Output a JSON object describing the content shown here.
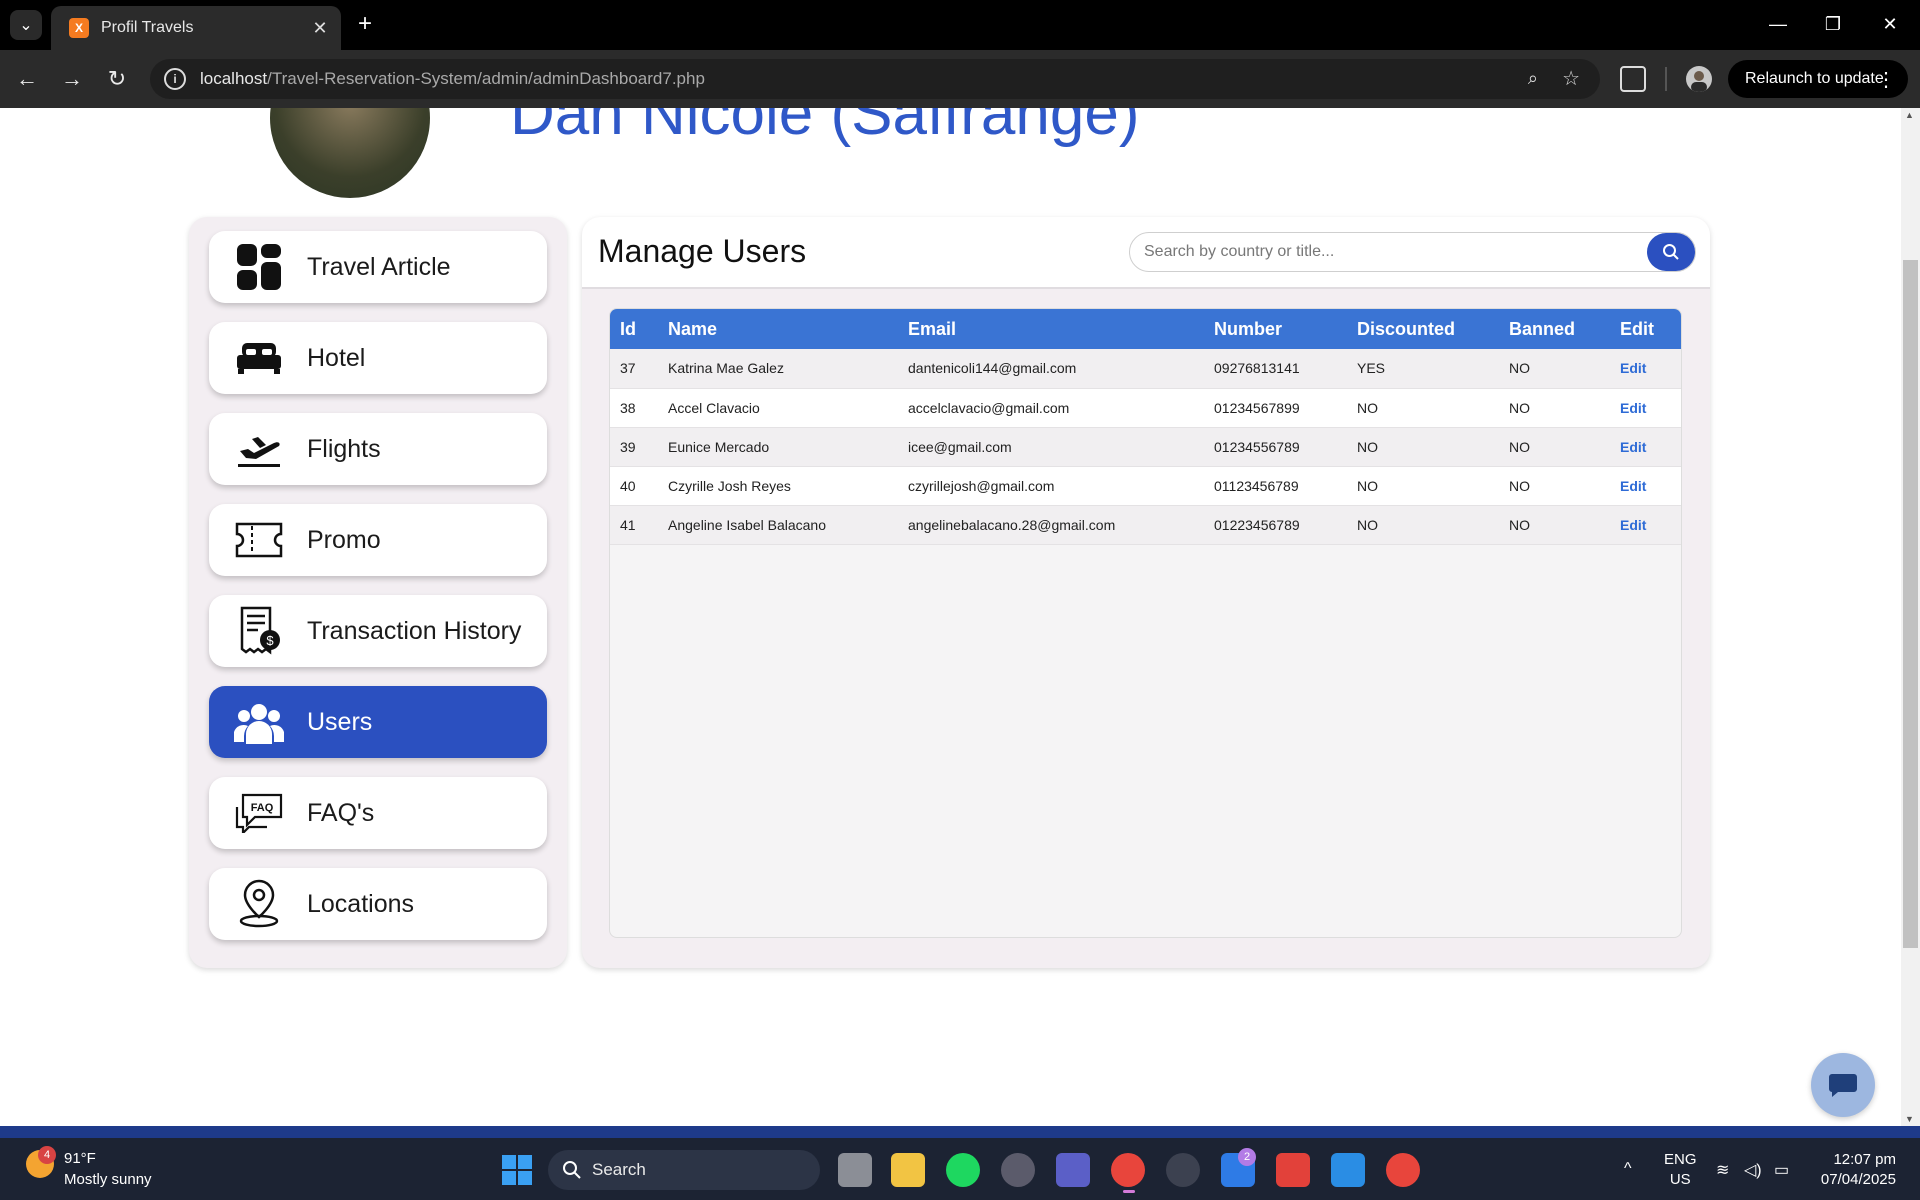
{
  "browser": {
    "tab_title": "Profil Travels",
    "url_host": "localhost",
    "url_path": "/Travel-Reservation-System/admin/adminDashboard7.php",
    "relaunch_label": "Relaunch to update"
  },
  "header": {
    "admin_name": "Dan Nicole (Saffrange)"
  },
  "sidebar": {
    "items": [
      {
        "label": "Travel Article",
        "icon": "dashboard-icon"
      },
      {
        "label": "Hotel",
        "icon": "bed-icon"
      },
      {
        "label": "Flights",
        "icon": "plane-departure-icon"
      },
      {
        "label": "Promo",
        "icon": "ticket-icon"
      },
      {
        "label": "Transaction History",
        "icon": "receipt-icon"
      },
      {
        "label": "Users",
        "icon": "users-icon",
        "active": true
      },
      {
        "label": "FAQ's",
        "icon": "faq-icon"
      },
      {
        "label": "Locations",
        "icon": "location-pin-icon"
      }
    ]
  },
  "main": {
    "title": "Manage Users",
    "search_placeholder": "Search by country or title...",
    "table": {
      "headers": [
        "Id",
        "Name",
        "Email",
        "Number",
        "Discounted",
        "Banned",
        "Edit"
      ],
      "rows": [
        {
          "id": "37",
          "name": "Katrina Mae Galez",
          "email": "dantenicoli144@gmail.com",
          "number": "09276813141",
          "discounted": "YES",
          "banned": "NO",
          "edit": "Edit"
        },
        {
          "id": "38",
          "name": "Accel Clavacio",
          "email": "accelclavacio@gmail.com",
          "number": "01234567899",
          "discounted": "NO",
          "banned": "NO",
          "edit": "Edit"
        },
        {
          "id": "39",
          "name": "Eunice Mercado",
          "email": "icee@gmail.com",
          "number": "01234556789",
          "discounted": "NO",
          "banned": "NO",
          "edit": "Edit"
        },
        {
          "id": "40",
          "name": "Czyrille Josh Reyes",
          "email": "czyrillejosh@gmail.com",
          "number": "01123456789",
          "discounted": "NO",
          "banned": "NO",
          "edit": "Edit"
        },
        {
          "id": "41",
          "name": "Angeline Isabel Balacano",
          "email": "angelinebalacano.28@gmail.com",
          "number": "01223456789",
          "discounted": "NO",
          "banned": "NO",
          "edit": "Edit"
        }
      ]
    }
  },
  "taskbar": {
    "weather_badge": "4",
    "weather_temp": "91°F",
    "weather_desc": "Mostly sunny",
    "search_label": "Search",
    "teams_badge": "2",
    "lang_line1": "ENG",
    "lang_line2": "US",
    "time": "12:07 pm",
    "date": "07/04/2025"
  },
  "colors": {
    "accent": "#2b50c0",
    "table_header": "#3a74d4",
    "edit_link": "#2e6bd6",
    "name_text": "#2f58c8"
  }
}
